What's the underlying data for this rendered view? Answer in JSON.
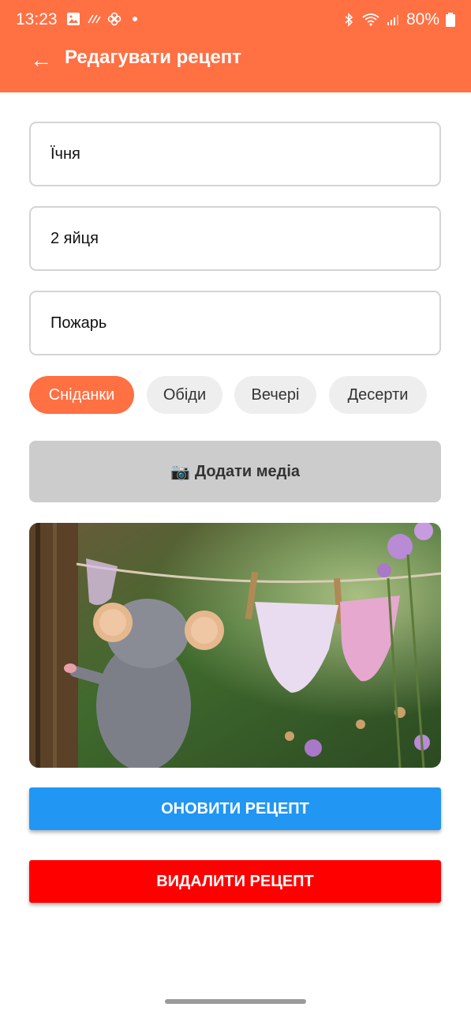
{
  "status_bar": {
    "time": "13:23",
    "battery": "80%"
  },
  "app_bar": {
    "back_icon": "←",
    "title": "Редагувати рецепт"
  },
  "form": {
    "name_value": "Їчня",
    "ingredients_value": "2 яйця",
    "steps_value": "Пожарь"
  },
  "categories": [
    {
      "label": "Сніданки",
      "selected": true
    },
    {
      "label": "Обіди",
      "selected": false
    },
    {
      "label": "Вечері",
      "selected": false
    },
    {
      "label": "Десерти",
      "selected": false
    }
  ],
  "media_button": {
    "icon": "📷",
    "label": "Додати медіа"
  },
  "media_preview": {
    "icon": "image-thumbnail"
  },
  "update_button": "ОНОВИТИ РЕЦЕПТ",
  "delete_button": "ВИДАЛИТИ РЕЦЕПТ",
  "colors": {
    "accent": "#FF7043",
    "update": "#2196F3",
    "delete": "#FF0000",
    "media_button_bg": "#CCCCCC",
    "chip_bg": "#EEEEEE"
  }
}
